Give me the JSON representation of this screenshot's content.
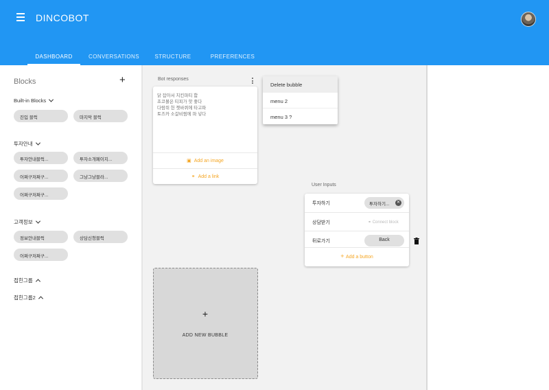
{
  "header": {
    "app_title": "DINCOBOT",
    "menu_icon": "hamburger-menu-icon",
    "avatar": "user-avatar",
    "color": "#2196f3"
  },
  "tabs": [
    {
      "label": "DASHBOARD",
      "active": true
    },
    {
      "label": "CONVERSATIONS",
      "active": false
    },
    {
      "label": "STRUCTURE",
      "active": false
    },
    {
      "label": "PREFERENCES",
      "active": false
    }
  ],
  "sidebar": {
    "title": "Blocks",
    "add_icon": "plus-icon",
    "groups": [
      {
        "label": "Built-in Blocks",
        "expanded": true,
        "chips": [
          "진입 블럭",
          "마지막 블럭"
        ]
      },
      {
        "label": "투자안내",
        "expanded": true,
        "chips": [
          "투자안내블럭...",
          "투자소개페이지...",
          "어쩌구저쩌구...",
          "그냥그냥블라...",
          "어쩌구저쩌구..."
        ]
      },
      {
        "label": "고객정보",
        "expanded": true,
        "chips": [
          "정보안내블럭",
          "상담신청블럭",
          "어쩌구저쩌구..."
        ]
      },
      {
        "label": "접힌그룹",
        "expanded": false,
        "chips": []
      },
      {
        "label": "접힌그룹2",
        "expanded": false,
        "chips": []
      }
    ]
  },
  "bot_responses": {
    "label": "Bot responses",
    "bubble_text": "닭 잡아서 치킨파티 함\n초코볼은 티피가 핫 좋다\n다람쥐 헌 쳇바퀴에 타고파\n토즈카 소갈비찜에 파 넣다",
    "add_image_label": "Add an image",
    "add_link_label": "Add a link",
    "accent_color": "#f5a623"
  },
  "dropdown_menu": {
    "items": [
      "Delete bubble",
      "menu 2",
      "menu 3 ?"
    ]
  },
  "user_inputs": {
    "label": "User Inputs",
    "rows": [
      {
        "label": "투자하기",
        "chip": "투자하기...",
        "connect": ""
      },
      {
        "label": "상담받기",
        "chip": "",
        "connect": "Connect block"
      },
      {
        "label": "뒤로가기",
        "chip": "Back",
        "connect": ""
      }
    ],
    "add_button_label": "Add a button"
  },
  "new_bubble": {
    "plus": "+",
    "label": "ADD NEW BUBBLE"
  }
}
